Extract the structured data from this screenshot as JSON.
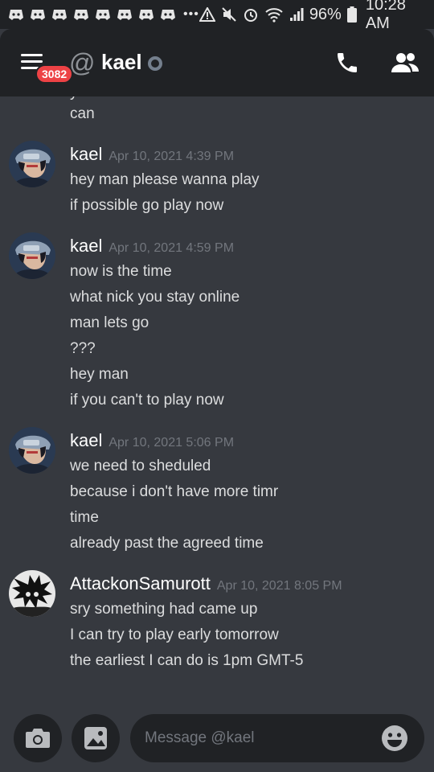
{
  "status_bar": {
    "battery": "96%",
    "time": "10:28 AM",
    "overflow": "•••"
  },
  "header": {
    "unread_badge": "3082",
    "at_symbol": "@",
    "channel_name": "kael",
    "status_color": "#747f8d"
  },
  "messages": {
    "partial_top_line": "y",
    "orphan_line": "can",
    "groups": [
      {
        "author": "kael",
        "timestamp": "Apr 10, 2021 4:39 PM",
        "avatar": "kael-avatar",
        "lines": [
          "hey man please wanna play",
          "if possible go play now"
        ]
      },
      {
        "author": "kael",
        "timestamp": "Apr 10, 2021 4:59 PM",
        "avatar": "kael-avatar",
        "lines": [
          "now is the time",
          "what nick you stay online",
          "man lets go",
          "???",
          "hey man",
          "if you can't to play now"
        ]
      },
      {
        "author": "kael",
        "timestamp": "Apr 10, 2021 5:06 PM",
        "avatar": "kael-avatar",
        "lines": [
          "we need to sheduled",
          "because i don't have more timr",
          "time",
          "already past the agreed time"
        ]
      },
      {
        "author": "AttackonSamurott",
        "timestamp": "Apr 10, 2021 8:05 PM",
        "avatar": "attackonsamurott-avatar",
        "lines": [
          "sry something had came up",
          "I can try to play early tomorrow",
          "the earliest I can do is 1pm GMT-5"
        ]
      }
    ]
  },
  "composer": {
    "placeholder": "Message @kael"
  },
  "colors": {
    "background": "#36393f",
    "header": "#202225",
    "badge": "#ed4245",
    "text": "#dcddde",
    "muted": "#72767d"
  }
}
